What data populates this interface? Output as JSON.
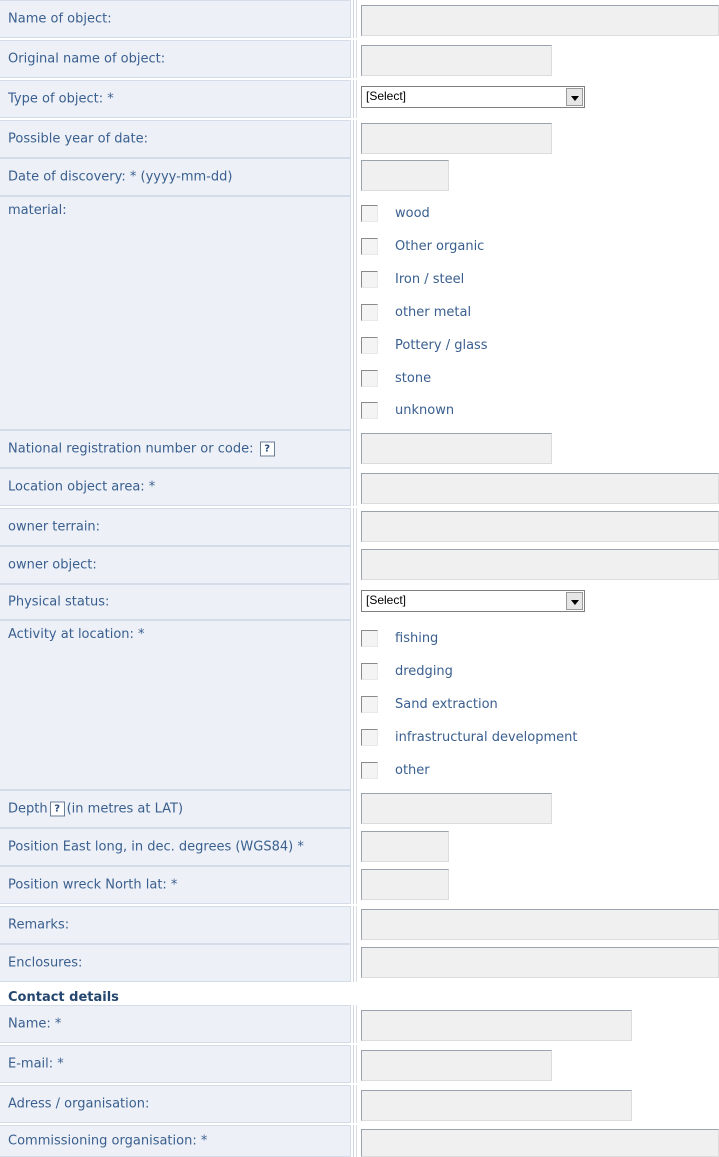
{
  "fields": {
    "name_of_object": "Name of object:",
    "original_name": "Original name of object:",
    "type_of_object": "Type of object: *",
    "type_select": "[Select]",
    "possible_year": "Possible year of date:",
    "date_of_discovery": "Date of discovery: * (yyyy-mm-dd)",
    "material": "material:",
    "materials": [
      "wood",
      "Other organic",
      "Iron / steel",
      "other metal",
      "Pottery / glass",
      "stone",
      "unknown"
    ],
    "registration": "National registration number or code:",
    "location_area": "Location object area: *",
    "owner_terrain": "owner terrain:",
    "owner_object": "owner object:",
    "physical_status": "Physical status:",
    "physical_select": "[Select]",
    "activity": "Activity at location: *",
    "activities": [
      "fishing",
      "dredging",
      "Sand extraction",
      "infrastructural development",
      "other"
    ],
    "depth_prefix": "Depth",
    "depth_suffix": "(in metres at LAT)",
    "position_east": "Position East long, in dec. degrees (WGS84) *",
    "position_north": "Position wreck North lat: *",
    "remarks": "Remarks:",
    "enclosures": "Enclosures:"
  },
  "help_icon_glyph": "?",
  "contact": {
    "heading": "Contact details",
    "name": "Name: *",
    "email": "E-mail: *",
    "address": "Adress / organisation:",
    "commissioning": "Commissioning organisation: *"
  }
}
